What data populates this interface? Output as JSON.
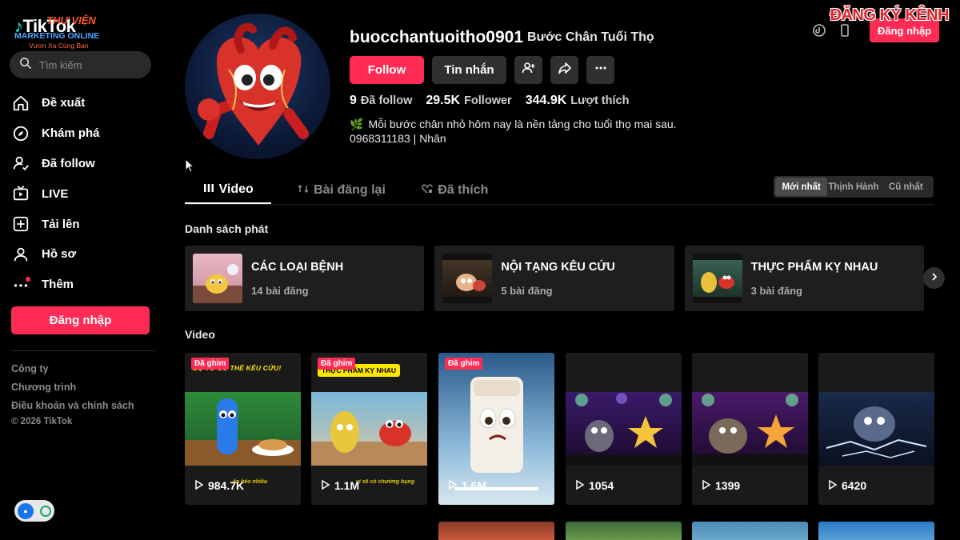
{
  "brand": {
    "logo_text": "TikTok",
    "overlay_library": "THƯ VIỆN",
    "overlay_marketing": "MARKETING ONLINE",
    "overlay_slogan": "Vươn Xa Cùng Bạn",
    "subscribe_banner": "ĐĂNG KÝ KÊNH"
  },
  "search": {
    "placeholder": "Tìm kiếm"
  },
  "sidebar": {
    "items": [
      {
        "label": "Đề xuất",
        "icon": "home-icon"
      },
      {
        "label": "Khám phá",
        "icon": "compass-icon"
      },
      {
        "label": "Đã follow",
        "icon": "following-icon"
      },
      {
        "label": "LIVE",
        "icon": "live-icon"
      },
      {
        "label": "Tải lên",
        "icon": "upload-icon"
      },
      {
        "label": "Hồ sơ",
        "icon": "profile-icon"
      },
      {
        "label": "Thêm",
        "icon": "more-icon"
      }
    ],
    "login_label": "Đăng nhập",
    "footer": [
      "Công ty",
      "Chương trình",
      "Điều khoản và chính sách"
    ],
    "copyright": "© 2026 TikTok"
  },
  "topbar": {
    "login_label": "Đăng nhập"
  },
  "profile": {
    "username": "buocchantuoitho0901",
    "nickname": "Bước Chân Tuổi Thọ",
    "follow_label": "Follow",
    "message_label": "Tin nhắn",
    "stats": {
      "following": "9",
      "following_label": "Đã follow",
      "followers": "29.5K",
      "followers_label": "Follower",
      "likes": "344.9K",
      "likes_label": "Lượt thích"
    },
    "bio_line1": "Mỗi bước chân nhỏ hôm nay là nền tảng cho tuổi thọ mai sau.",
    "bio_line2": "0968311183 | Nhân"
  },
  "tabs": [
    {
      "label": "Video",
      "active": true
    },
    {
      "label": "Bài đăng lại",
      "active": false
    },
    {
      "label": "Đã thích",
      "active": false
    }
  ],
  "sort": [
    "Mới nhất",
    "Thịnh Hành",
    "Cũ nhất"
  ],
  "playlists_title": "Danh sách phát",
  "playlists": [
    {
      "title": "CÁC LOẠI BỆNH",
      "count": "14 bài đăng"
    },
    {
      "title": "NỘI TẠNG KÊU CỨU",
      "count": "5 bài đăng"
    },
    {
      "title": "THỰC PHẨM KỴ NHAU",
      "count": "3 bài đăng"
    }
  ],
  "videos_title": "Video",
  "videos": [
    {
      "views": "984.7K",
      "pinned": "Đã ghim",
      "caption": "BỘ TỨ CÓ THỂ KÊU CỨU!",
      "subcaption": "ăn béo nhiều"
    },
    {
      "views": "1.1M",
      "pinned": "Đã ghim",
      "caption": "THỰC PHẨM KỴ NHAU",
      "subcaption": "vì sẽ có chướng bụng"
    },
    {
      "views": "1.6M",
      "pinned": "Đã ghim"
    },
    {
      "views": "1054"
    },
    {
      "views": "1399"
    },
    {
      "views": "6420"
    }
  ],
  "colors": {
    "accent": "#fe2c55",
    "background": "#000000",
    "card": "#1e1e1e"
  }
}
